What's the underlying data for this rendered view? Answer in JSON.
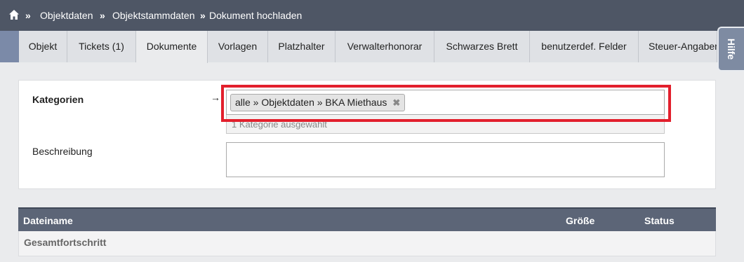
{
  "breadcrumb": {
    "items": [
      "Objektdaten",
      "Objektstammdaten",
      "Dokument hochladen"
    ],
    "separator": "»"
  },
  "tabs": [
    {
      "label": "Objekt"
    },
    {
      "label": "Tickets (1)"
    },
    {
      "label": "Dokumente",
      "active": true
    },
    {
      "label": "Vorlagen"
    },
    {
      "label": "Platzhalter"
    },
    {
      "label": "Verwalterhonorar"
    },
    {
      "label": "Schwarzes Brett"
    },
    {
      "label": "benutzerdef. Felder"
    },
    {
      "label": "Steuer-Angaben"
    }
  ],
  "help_tab": {
    "label": "Hilfe"
  },
  "form": {
    "kategorien_label": "Kategorien",
    "selected_category": "alle » Objektdaten » BKA Miethaus",
    "remove_symbol": "✖",
    "selection_count_text": "1 Kategorie ausgewählt",
    "beschreibung_label": "Beschreibung",
    "beschreibung_value": ""
  },
  "table": {
    "columns": [
      "Dateiname",
      "Größe",
      "Status"
    ],
    "rows": [
      "Gesamtfortschritt"
    ]
  },
  "colors": {
    "topbar": "#4e5665",
    "tab_accent": "#7b8aa8",
    "table_header": "#5c6577",
    "highlight": "#e21f2c"
  }
}
